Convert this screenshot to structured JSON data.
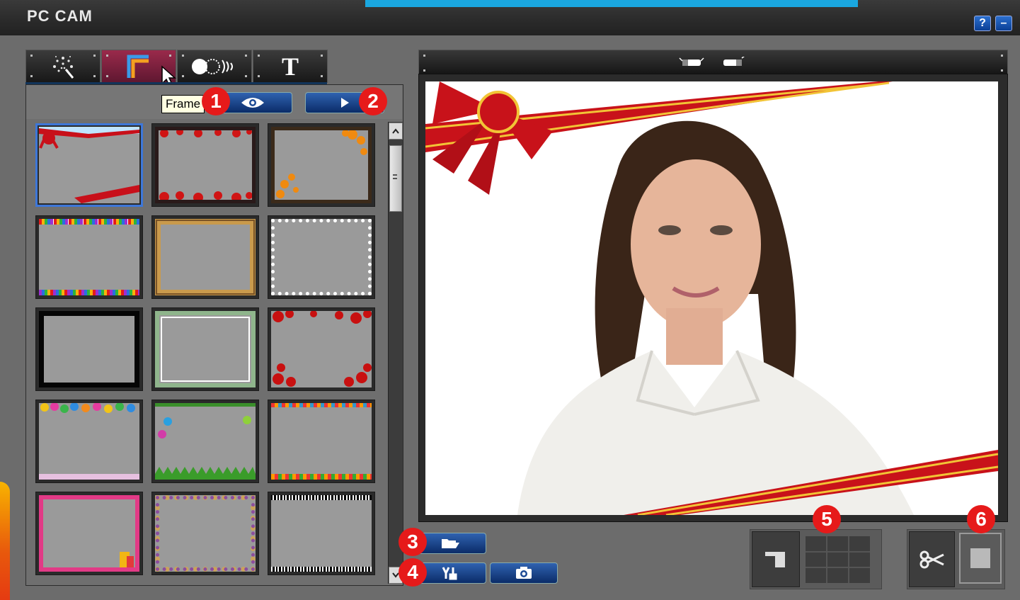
{
  "window": {
    "title": "PC CAM",
    "help_label": "?",
    "minimize_label": "–",
    "accent_color": "#1aa7e0"
  },
  "tabs": [
    {
      "icon": "sparkle-effects-icon",
      "label": ""
    },
    {
      "icon": "frame-icon",
      "label": "",
      "active": true
    },
    {
      "icon": "morph-icon",
      "label": ""
    },
    {
      "icon": "text-icon",
      "label": "T"
    }
  ],
  "tooltip": {
    "text": "Frame"
  },
  "badges": [
    "1",
    "2",
    "3",
    "4",
    "5",
    "6"
  ],
  "frames": [
    {
      "name": "red-ribbon-frame"
    },
    {
      "name": "red-flowers-frame"
    },
    {
      "name": "autumn-leaves-frame"
    },
    {
      "name": "rainbow-pencils-frame"
    },
    {
      "name": "gold-ornate-frame"
    },
    {
      "name": "white-stamp-frame"
    },
    {
      "name": "black-film-frame"
    },
    {
      "name": "green-paper-frame"
    },
    {
      "name": "red-roses-frame"
    },
    {
      "name": "balloons-frame"
    },
    {
      "name": "christmas-baubles-frame"
    },
    {
      "name": "candy-lights-frame"
    },
    {
      "name": "pink-birthday-frame"
    },
    {
      "name": "confetti-frame"
    },
    {
      "name": "barcode-frame"
    }
  ],
  "colors": {
    "badge": "#e61a1a",
    "button": "#1d4a95",
    "selection": "#3d77d9"
  }
}
